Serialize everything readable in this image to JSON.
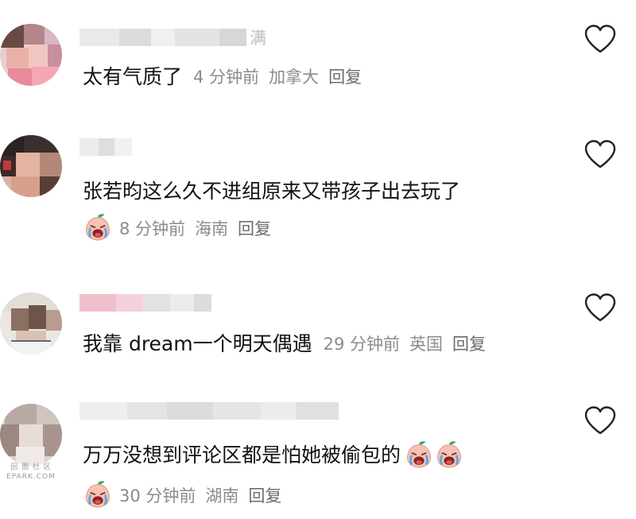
{
  "comments": [
    {
      "name_visible_tail": "满",
      "text": "太有气质了",
      "time": "4 分钟前",
      "location": "加拿大",
      "reply": "回复"
    },
    {
      "name_visible_tail": "",
      "text": "张若昀这么久不进组原来又带孩子出去玩了",
      "time": "8 分钟前",
      "location": "海南",
      "reply": "回复"
    },
    {
      "name_visible_tail": "",
      "text": "我靠 dream一个明天偶遇",
      "time": "29 分钟前",
      "location": "英国",
      "reply": "回复"
    },
    {
      "name_visible_tail": "",
      "text": "万万没想到评论区都是怕她被偷包的",
      "time": "30 分钟前",
      "location": "湖南",
      "reply": "回复"
    }
  ],
  "watermark": {
    "line1": "回 图 社 区",
    "line2": "EPARK.COM"
  },
  "icons": {
    "like": "heart-outline-icon",
    "emoji": "crying-peach-emoji-icon"
  },
  "colors": {
    "text": "#111111",
    "meta": "#8a8b91",
    "heart_stroke": "#222222",
    "emoji_face": "#f7c2b3",
    "emoji_leaf": "#3aa76d"
  }
}
